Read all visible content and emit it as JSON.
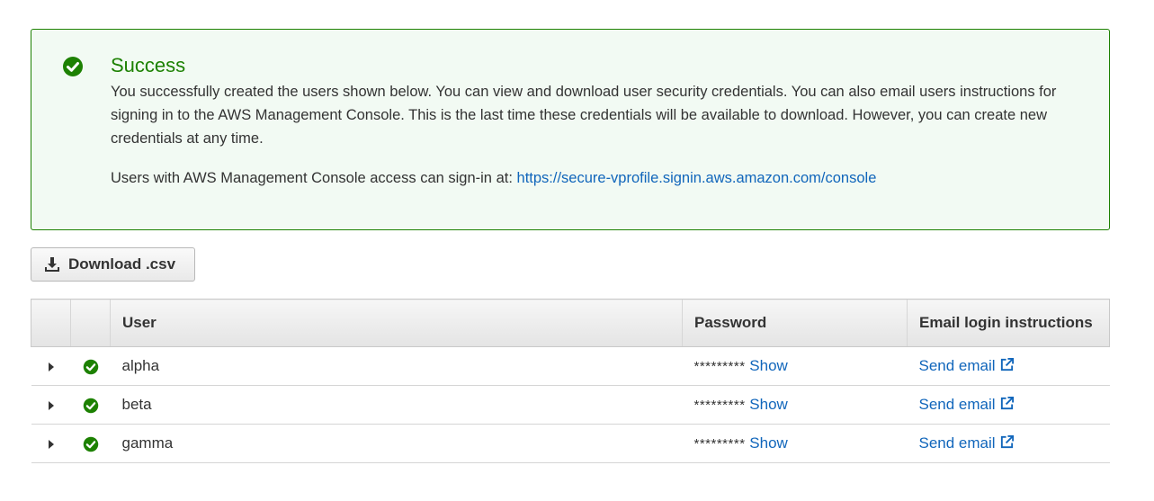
{
  "alert": {
    "icon": "check-circle-icon",
    "title": "Success",
    "body": "You successfully created the users shown below. You can view and download user security credentials. You can also email users instructions for signing in to the AWS Management Console. This is the last time these credentials will be available to download. However, you can create new credentials at any time.",
    "signin_prefix": "Users with AWS Management Console access can sign-in at: ",
    "signin_url": "https://secure-vprofile.signin.aws.amazon.com/console"
  },
  "toolbar": {
    "download_icon": "download-icon",
    "download_label": "Download .csv"
  },
  "table": {
    "columns": {
      "user": "User",
      "password": "Password",
      "email": "Email login instructions"
    },
    "rows": [
      {
        "user": "alpha",
        "password_mask": "*********",
        "show_label": "Show",
        "email_label": "Send email"
      },
      {
        "user": "beta",
        "password_mask": "*********",
        "show_label": "Show",
        "email_label": "Send email"
      },
      {
        "user": "gamma",
        "password_mask": "*********",
        "show_label": "Show",
        "email_label": "Send email"
      }
    ]
  },
  "colors": {
    "success": "#1d8102",
    "success_bg": "#f2faf3",
    "link": "#1166bb",
    "text": "#333333"
  }
}
